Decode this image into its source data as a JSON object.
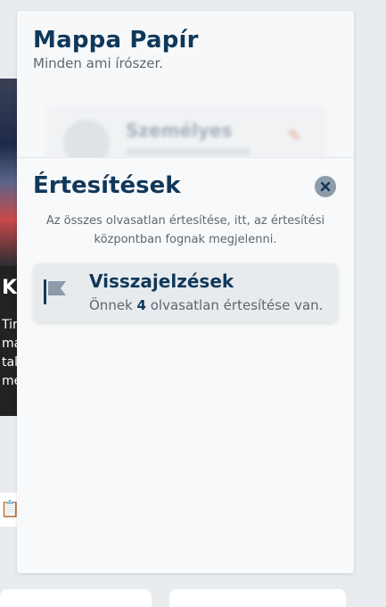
{
  "background": {
    "left_card": {
      "heading_fragment": "K",
      "text_fragments": [
        "Tir",
        "ma",
        "tal",
        "me"
      ]
    }
  },
  "sidebar": {
    "shop_title": "Mappa Papír",
    "shop_subtitle": "Minden ami írószer.",
    "profile_preview": {
      "name": "Személyes"
    }
  },
  "notifications": {
    "title": "Értesítések",
    "description": "Az összes olvasatlan értesítése, itt, az értesítési központban fognak megjelenni.",
    "items": [
      {
        "title": "Visszajelzések",
        "text_before": "Önnek",
        "count": "4",
        "text_after": "olvasatlan értesítése van.",
        "icon": "flag-icon"
      }
    ]
  },
  "colors": {
    "primary": "#10385a",
    "muted_text": "#5e6770",
    "panel_bg": "#f7f8f9",
    "page_bg": "#e9ecef",
    "item_bg": "#e8ebee",
    "flag_color": "#8d9bab"
  }
}
